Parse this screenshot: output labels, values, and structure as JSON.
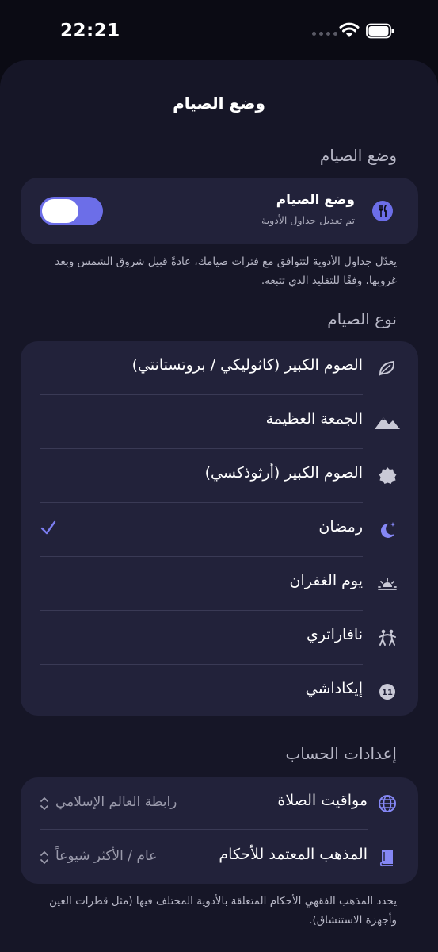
{
  "status": {
    "time": "22:21"
  },
  "sheet": {
    "title": "وضع الصيام"
  },
  "fasting_section": {
    "header": "وضع الصيام",
    "toggle_title": "وضع الصيام",
    "toggle_subtitle": "تم تعديل جداول الأدوية",
    "toggle_on": true,
    "note": "يعدّل جداول الأدوية لتتوافق مع فترات صيامك، عادةً قبيل شروق الشمس وبعد غروبها، وفقًا للتقليد الذي تتبعه."
  },
  "fast_type": {
    "header": "نوع الصيام",
    "items": [
      {
        "label": "الصوم الكبير (كاثوليكي / بروتستانتي)",
        "icon": "leaf-icon",
        "selected": false
      },
      {
        "label": "الجمعة العظيمة",
        "icon": "mountains-icon",
        "selected": false
      },
      {
        "label": "الصوم الكبير (أرثوذكسي)",
        "icon": "badge-star-icon",
        "selected": false
      },
      {
        "label": "رمضان",
        "icon": "crescent-moon-icon",
        "selected": true
      },
      {
        "label": "يوم الغفران",
        "icon": "sunset-icon",
        "selected": false
      },
      {
        "label": "نافاراتري",
        "icon": "dance-icon",
        "selected": false
      },
      {
        "label": "إيكاداشي",
        "icon": "number-11-icon",
        "selected": false
      }
    ]
  },
  "account": {
    "header": "إعدادات الحساب",
    "prayer_label": "مواقيت الصلاة",
    "prayer_value": "رابطة العالم الإسلامي",
    "school_label": "المذهب المعتمد للأحكام",
    "school_value": "عام / الأكثر شيوعاً",
    "note": "يحدد المذهب الفقهي الأحكام المتعلقة بالأدوية المختلف فيها (مثل قطرات العين وأجهزة الاستنشاق)."
  },
  "colors": {
    "accent": "#6c6ee8",
    "card": "#22223a",
    "sheet": "#161627",
    "background": "#0b0b14"
  }
}
